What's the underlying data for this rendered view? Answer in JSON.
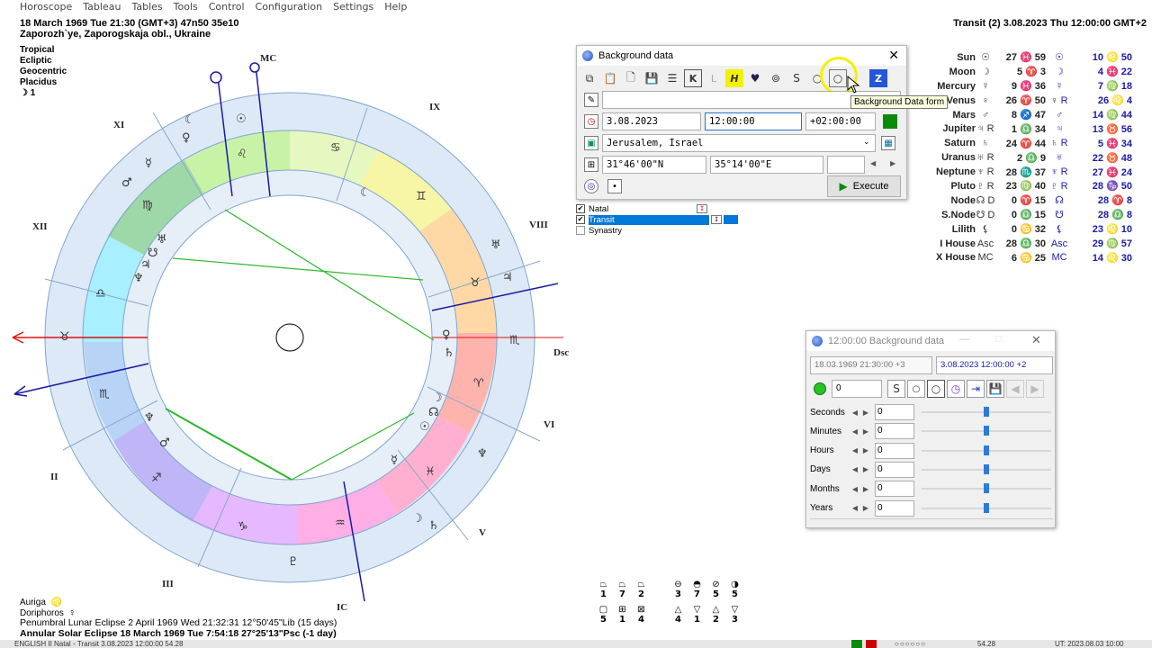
{
  "menu": [
    "Horoscope",
    "Tableau",
    "Tables",
    "Tools",
    "Control",
    "Configuration",
    "Settings",
    "Help"
  ],
  "natal": {
    "line1": "18 March 1969  Tue  21:30 (GMT+3) 47n50  35e10",
    "line2": "Zaporozh`ye, Zaporogskaja obl., Ukraine",
    "settings": [
      "Tropical",
      "Ecliptic",
      "Geocentric",
      "Placidus"
    ],
    "moon_phase": "☽  1"
  },
  "transit_header": "Transit (2)  3.08.2023  Thu 12:00:00 GMT+2",
  "chart_labels": {
    "mc": "MC",
    "ic": "IC",
    "dsc": "Dsc",
    "houses": [
      "IX",
      "VIII",
      "VI",
      "V",
      "III",
      "II",
      "XII",
      "XI"
    ]
  },
  "planets": [
    {
      "name": "Sun",
      "g1": "☉",
      "v1": "27 ♓ 59",
      "g2": "☉",
      "v2": "10 ♌ 50"
    },
    {
      "name": "Moon",
      "g1": "☽",
      "v1": "5 ♈ 3",
      "g2": "☽",
      "v2": "4 ♓ 22"
    },
    {
      "name": "Mercury",
      "g1": "☿",
      "v1": "9 ♓ 36",
      "g2": "☿",
      "v2": "7 ♍ 18"
    },
    {
      "name": "Venus",
      "g1": "♀",
      "v1": "26 ♈ 50",
      "g2": "♀ R",
      "v2": "26 ♌ 4"
    },
    {
      "name": "Mars",
      "g1": "♂",
      "v1": "8 ♐ 47",
      "g2": "♂",
      "v2": "14 ♍ 44"
    },
    {
      "name": "Jupiter",
      "g1": "♃ R",
      "v1": "1 ♎ 34",
      "g2": "♃",
      "v2": "13 ♉ 56"
    },
    {
      "name": "Saturn",
      "g1": "♄",
      "v1": "24 ♈ 44",
      "g2": "♄ R",
      "v2": "5 ♓ 34"
    },
    {
      "name": "Uranus",
      "g1": "♅ R",
      "v1": "2 ♎ 9",
      "g2": "♅",
      "v2": "22 ♉ 48"
    },
    {
      "name": "Neptune",
      "g1": "♆ R",
      "v1": "28 ♏ 37",
      "g2": "♆ R",
      "v2": "27 ♓ 24"
    },
    {
      "name": "Pluto",
      "g1": "♇ R",
      "v1": "23 ♍ 40",
      "g2": "♇ R",
      "v2": "28 ♑ 50"
    },
    {
      "name": "Node",
      "g1": "☊ D",
      "v1": "0 ♈ 15",
      "g2": "☊",
      "v2": "28 ♈ 8"
    },
    {
      "name": "S.Node",
      "g1": "☋ D",
      "v1": "0 ♎ 15",
      "g2": "☋",
      "v2": "28 ♎ 8"
    },
    {
      "name": "Lilith",
      "g1": "⚸",
      "v1": "0 ♋ 32",
      "g2": "⚸",
      "v2": "23 ♌ 10"
    },
    {
      "name": "I House",
      "g1": "Asc",
      "v1": "28 ♎ 30",
      "g2": "Asc",
      "v2": "29 ♍ 57"
    },
    {
      "name": "X House",
      "g1": "MC",
      "v1": "6 ♋ 25",
      "g2": "MC",
      "v2": "14 ♌ 30"
    }
  ],
  "bg_dialog": {
    "title": "Background data",
    "tooltip": "Background Data form",
    "date": "3.08.2023",
    "time": "12:00:00",
    "tz": "+02:00:00",
    "place": "Jerusalem, Israel",
    "lat": "31°46'00\"N",
    "lon": "35°14'00\"E",
    "execute": "Execute"
  },
  "chart_list": [
    {
      "label": "Natal",
      "checked": true
    },
    {
      "label": "Transit",
      "checked": true
    },
    {
      "label": "Synastry",
      "checked": false
    }
  ],
  "bg_dialog2": {
    "title": "12:00:00 Background data",
    "natal_date": "18.03.1969  21:30:00  +3",
    "transit_date": "3.08.2023   12:00:00  +2",
    "input0": "0",
    "rows": [
      {
        "label": "Seconds",
        "value": "0"
      },
      {
        "label": "Minutes",
        "value": "0"
      },
      {
        "label": "Hours",
        "value": "0"
      },
      {
        "label": "Days",
        "value": "0"
      },
      {
        "label": "Months",
        "value": "0"
      },
      {
        "label": "Years",
        "value": "0"
      }
    ]
  },
  "stars": [
    {
      "name": "Auriga",
      "glyph": "♌"
    },
    {
      "name": "Doriphoros",
      "glyph": "☿"
    }
  ],
  "eclipses": [
    "Penumbral Lunar Eclipse 2 April 1969 Wed 21:32:31 12°50'45\"Lib (15 days)",
    "Annular Solar Eclipse 18 March 1969 Tue  7:54:18 27°25'13\"Psc (-1 day)"
  ],
  "aspect_counts": {
    "row1": [
      "1",
      "7",
      "2",
      "3",
      "7",
      "5",
      "5"
    ],
    "row2": [
      "5",
      "1",
      "4",
      "4",
      "1",
      "2",
      "3"
    ]
  },
  "status": {
    "left": "ENGLISH     II Natal       ◦ Transit   3.08.2023 12:00:00   54.28",
    "mid": "54.28",
    "right": "UT: 2023.08.03 10:00"
  }
}
